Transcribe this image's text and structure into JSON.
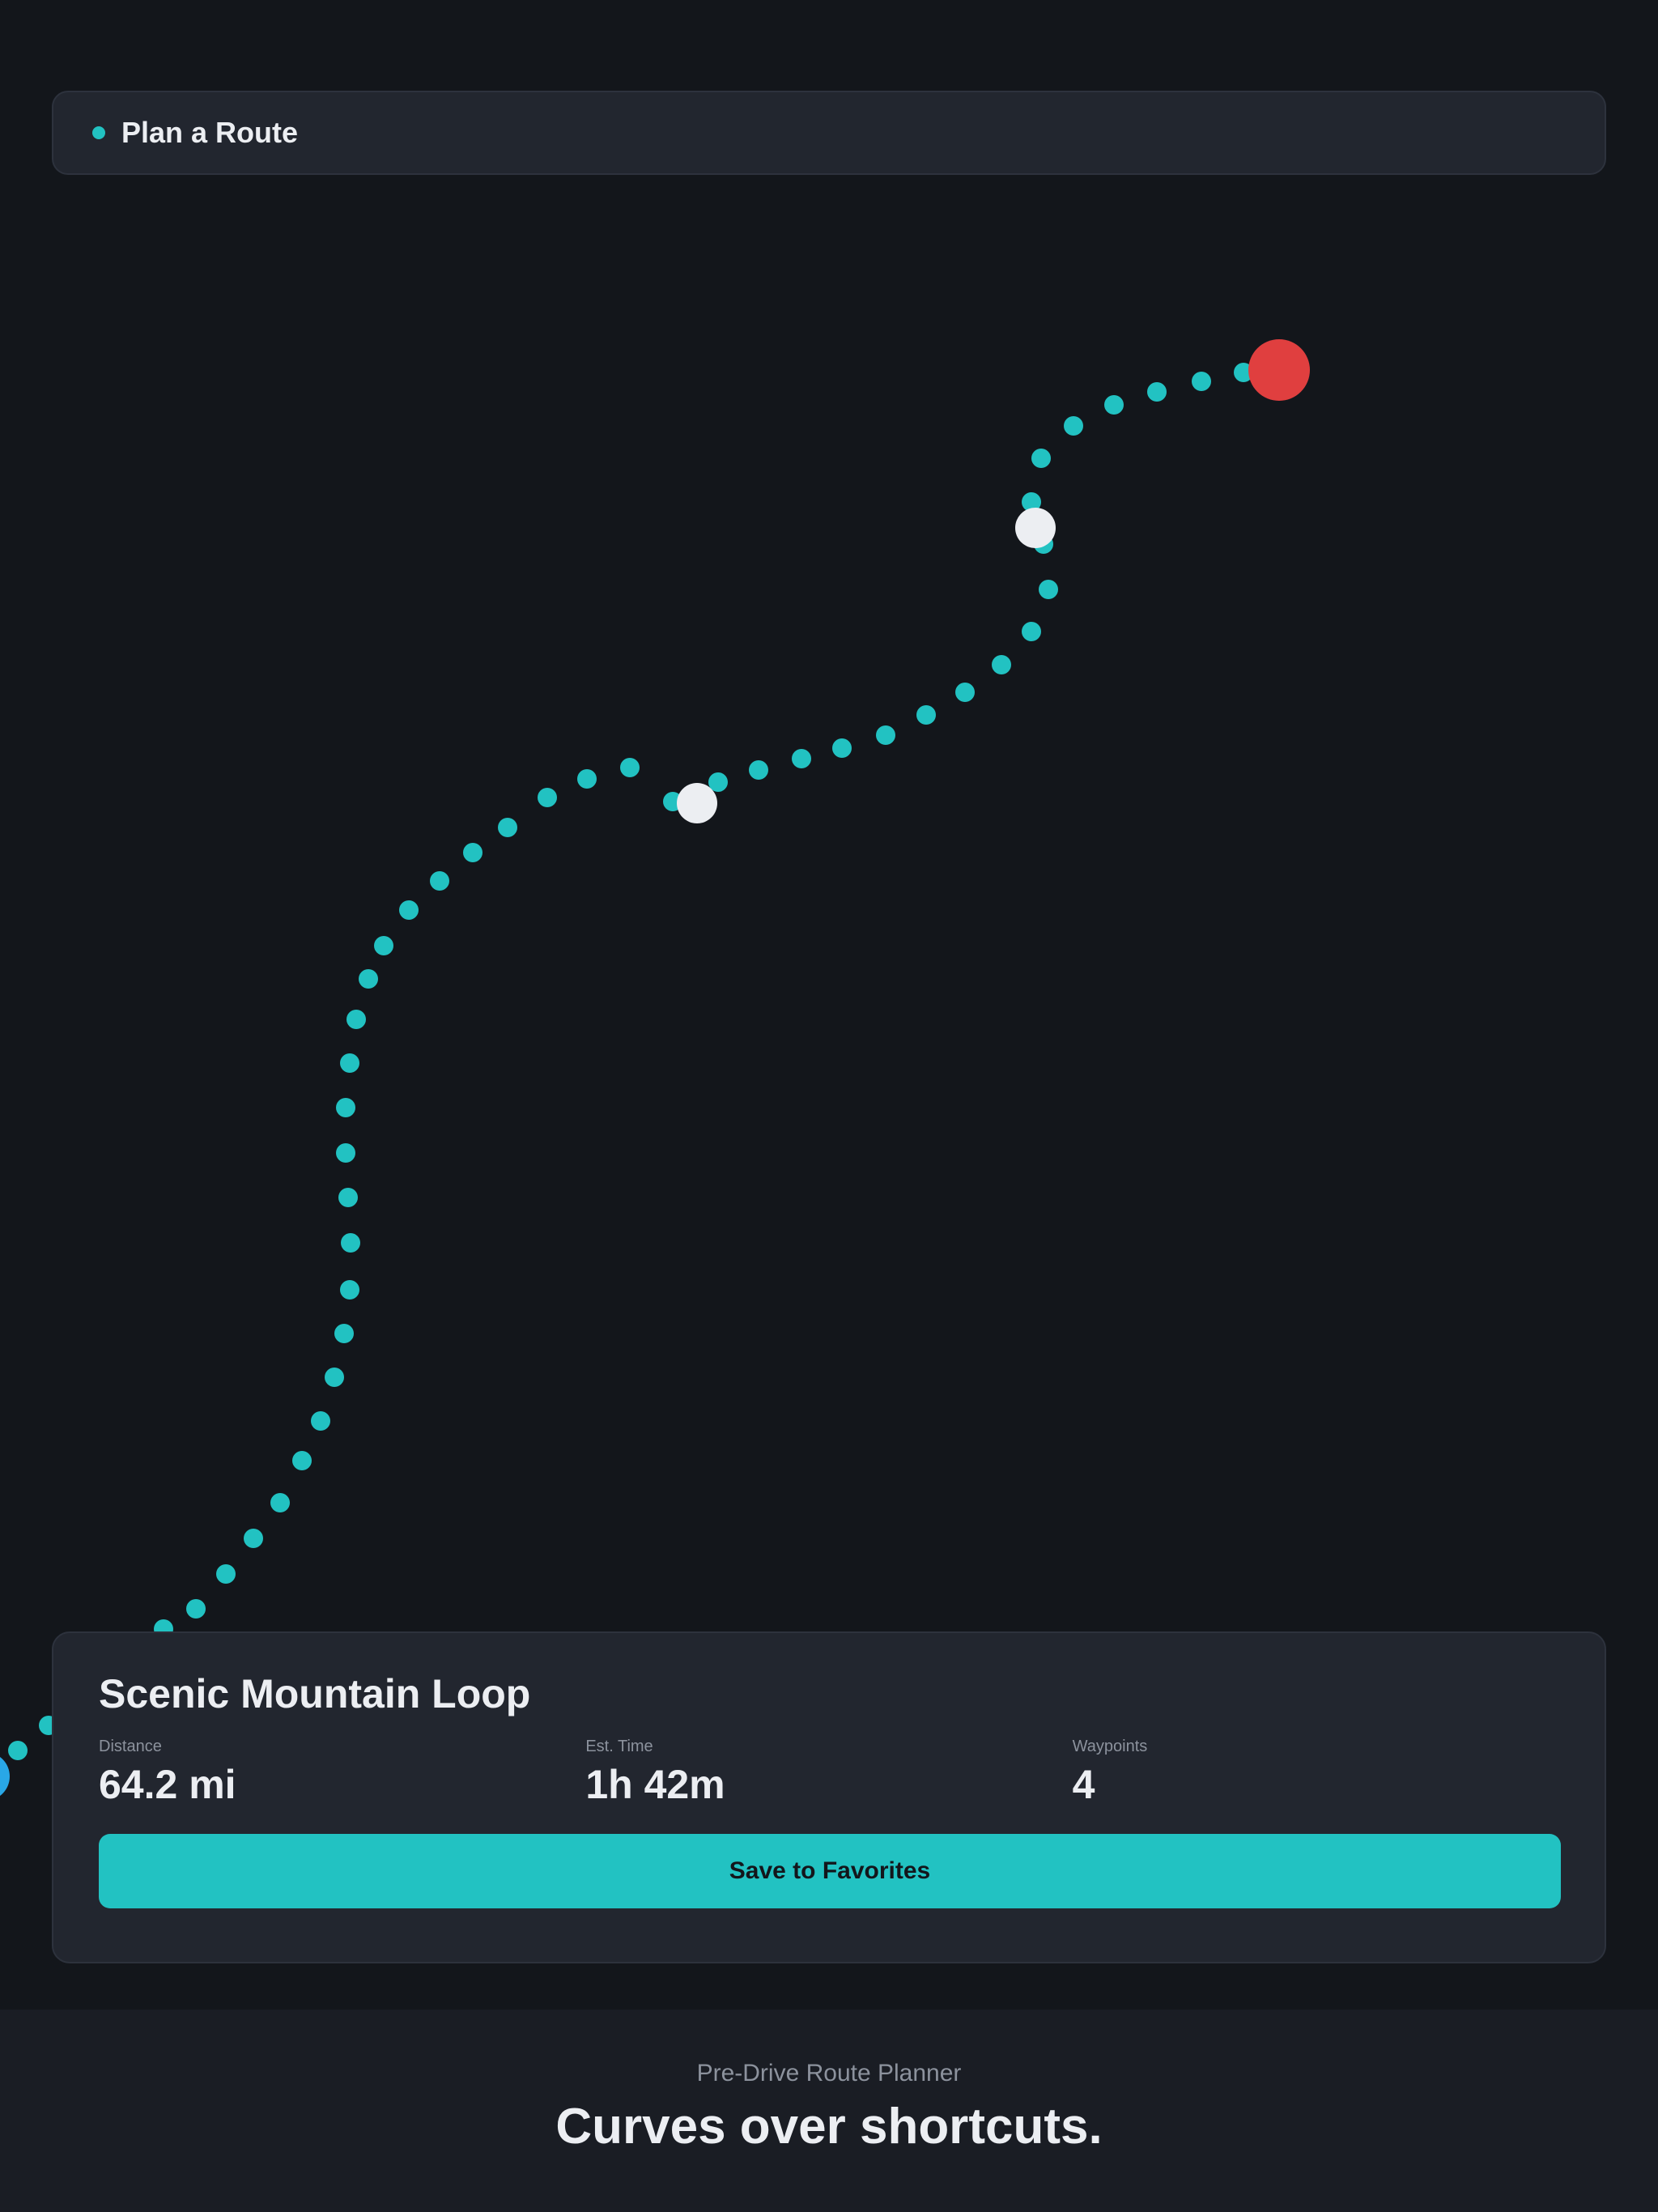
{
  "header": {
    "title": "Plan a Route"
  },
  "route": {
    "name": "Scenic Mountain Loop",
    "stats": [
      {
        "label": "Distance",
        "value": "64.2 mi"
      },
      {
        "label": "Est. Time",
        "value": "1h 42m"
      },
      {
        "label": "Waypoints",
        "value": "4"
      }
    ],
    "save_label": "Save to Favorites"
  },
  "map": {
    "route_color": "#22c2c2",
    "start_color": "#29a7e6",
    "end_color": "#e03f3f",
    "waypoint_color": "#eceef2"
  },
  "footer": {
    "eyebrow": "Pre-Drive Route Planner",
    "tagline": "Curves over shortcuts."
  }
}
